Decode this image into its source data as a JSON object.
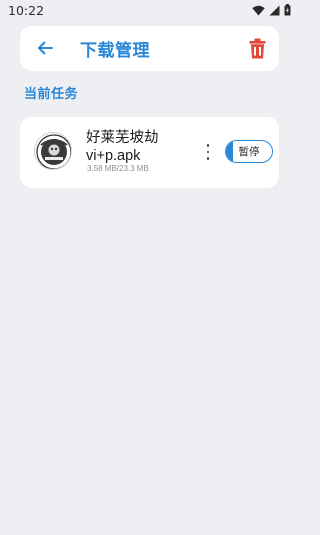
{
  "status_bar": {
    "time": "10:22"
  },
  "header": {
    "title": "下载管理",
    "back_icon": "arrow-left-icon",
    "delete_icon": "trash-icon",
    "accent_color": "#2a87d8",
    "delete_color": "#e0483c"
  },
  "section": {
    "label": "当前任务"
  },
  "tasks": [
    {
      "name": "好莱芜坡劫vi+p.apk",
      "size": "3.58 MB/23.3 MB",
      "action_label": "暂停",
      "progress": 0.154,
      "more_icon": "more-vertical-icon"
    }
  ]
}
